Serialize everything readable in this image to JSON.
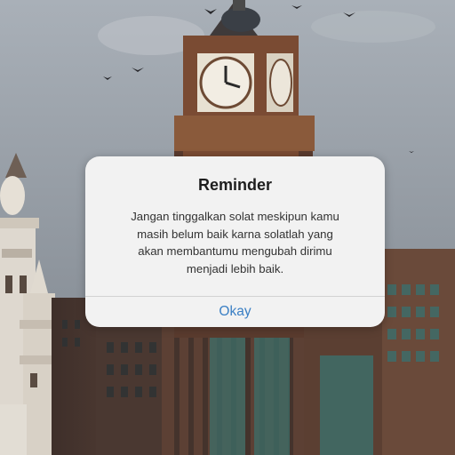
{
  "dialog": {
    "title": "Reminder",
    "message_lines": [
      "Jangan tinggalkan solat meskipun kamu",
      "masih belum baik karna solatlah yang",
      "akan membantumu mengubah dirimu",
      "menjadi lebih baik."
    ],
    "button_label": "Okay"
  },
  "colors": {
    "sky": "#8d949c",
    "dialog_background": "#f2f2f2",
    "button_text": "#3a7fc4"
  },
  "icons": [
    "clock-face-icon",
    "bird-icon"
  ]
}
